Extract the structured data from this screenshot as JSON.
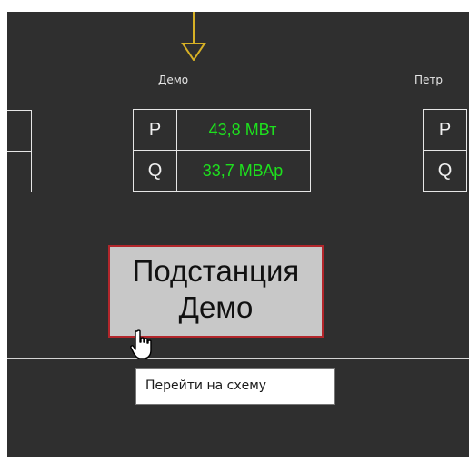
{
  "substations": {
    "demo": {
      "name": "Демо",
      "p_label": "P",
      "p_value": "43,8 МВт",
      "q_label": "Q",
      "q_value": "33,7 МВАр"
    },
    "right_partial": {
      "name": "Петр",
      "p_label": "P",
      "q_label": "Q"
    }
  },
  "button": {
    "line1": "Подстанция",
    "line2": "Демо"
  },
  "tooltip": {
    "text": "Перейти на схему"
  },
  "colors": {
    "background": "#2f2f2f",
    "measurement_value": "#1ee01e",
    "button_fill": "#c8c8c8",
    "button_border": "#b2262b",
    "feeder": "#d7b125"
  },
  "icons": {
    "feeder_arrow": "down-triangle-arrow-icon",
    "cursor": "hand-pointer-cursor-icon"
  }
}
